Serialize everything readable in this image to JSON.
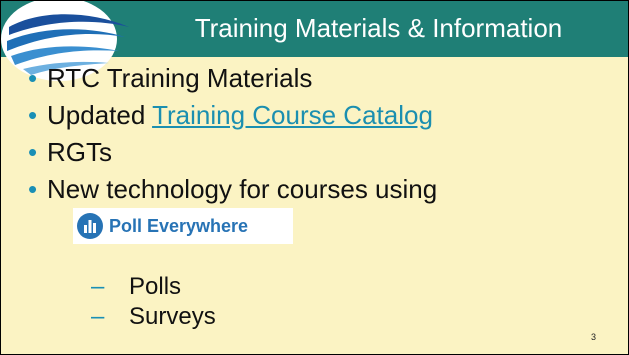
{
  "slide": {
    "title": "Training Materials & Information",
    "bullets": [
      {
        "prefix": "RTC Training Materials",
        "link": ""
      },
      {
        "prefix": "Updated ",
        "link": "Training Course Catalog"
      },
      {
        "prefix": "RGTs",
        "link": ""
      },
      {
        "prefix": "New technology for courses using",
        "link": ""
      }
    ],
    "bullet_char": "•",
    "logo_text": "Poll Everywhere",
    "sub_bullets": [
      "Polls",
      "Surveys"
    ],
    "dash_char": "–",
    "page_number": "3"
  },
  "colors": {
    "title_bar": "#1f7f76",
    "background": "#fbf3c3",
    "bullet": "#1a8fb5",
    "link": "#1b8fb0",
    "poll_brand": "#2773b5"
  },
  "icons": [
    "agency-logo-icon",
    "poll-everywhere-icon"
  ]
}
